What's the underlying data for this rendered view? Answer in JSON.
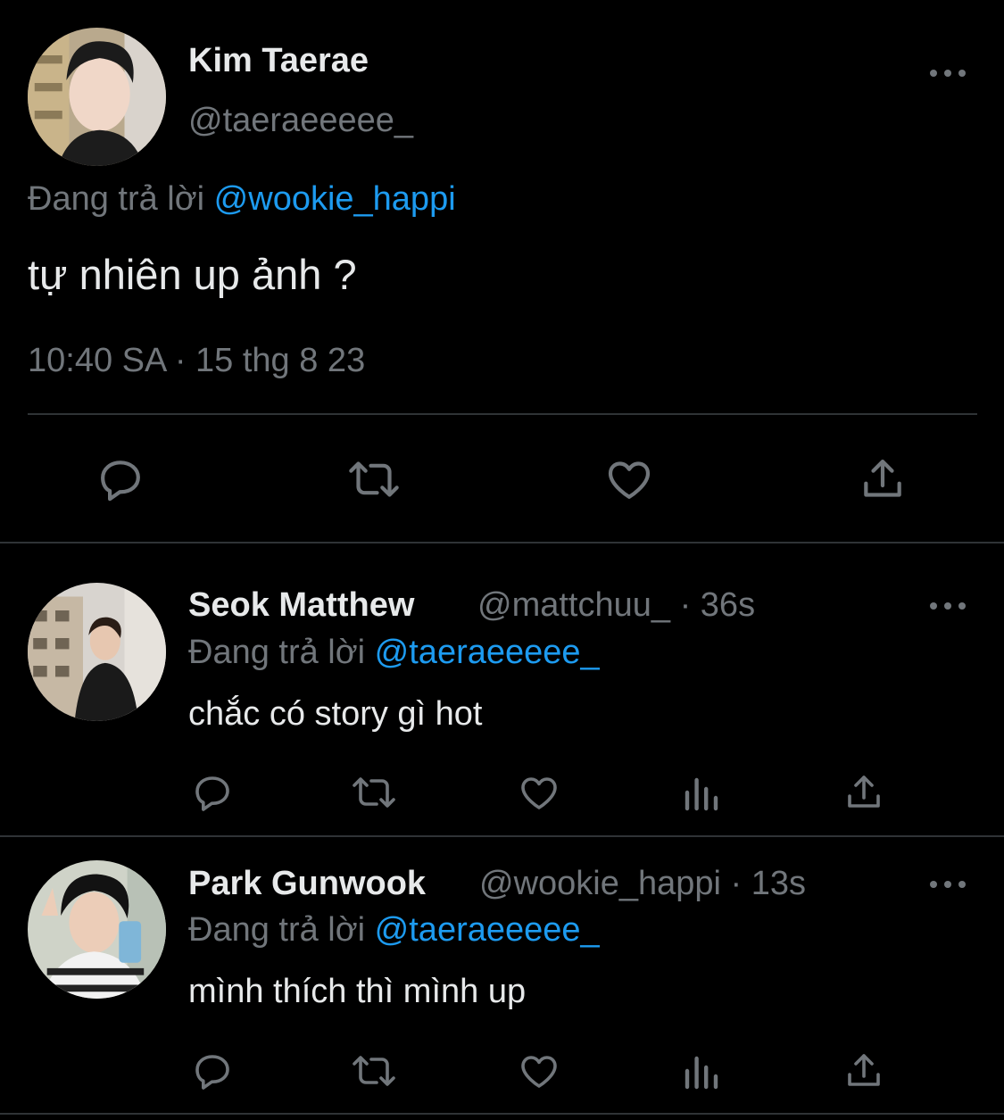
{
  "colors": {
    "background": "#000000",
    "primary_text": "#e7e9ea",
    "secondary_text": "#71767b",
    "mention": "#1d9bf0",
    "divider": "#2f3336"
  },
  "main_tweet": {
    "display_name": "Kim Taerae",
    "handle": "@taeraeeeee_",
    "reply_prefix": "Đang trả lời",
    "reply_to": "@wookie_happi",
    "text": "tự nhiên up ảnh ?",
    "time": "10:40 SA",
    "separator": "·",
    "date": "15 thg 8 23",
    "actions": [
      "reply-icon",
      "retweet-icon",
      "like-icon",
      "share-icon"
    ]
  },
  "replies": [
    {
      "display_name": "Seok Matthew",
      "handle": "@mattchuu_",
      "separator": "·",
      "age": "36s",
      "reply_prefix": "Đang trả lời",
      "reply_to": "@taeraeeeee_",
      "text": "chắc có story gì hot",
      "actions": [
        "reply-icon",
        "retweet-icon",
        "like-icon",
        "analytics-icon",
        "share-icon"
      ]
    },
    {
      "display_name": "Park Gunwook",
      "handle": "@wookie_happi",
      "separator": "·",
      "age": "13s",
      "reply_prefix": "Đang trả lời",
      "reply_to": "@taeraeeeee_",
      "text": "mình thích thì mình up",
      "actions": [
        "reply-icon",
        "retweet-icon",
        "like-icon",
        "analytics-icon",
        "share-icon"
      ]
    }
  ]
}
